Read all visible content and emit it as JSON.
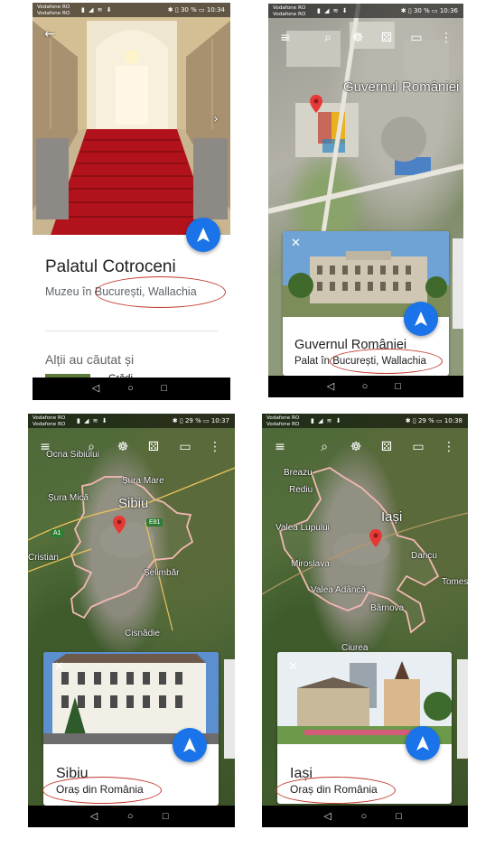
{
  "screens": [
    {
      "status": {
        "carrier1": "Vodafone RO",
        "carrier2": "Vodafone RO",
        "battery": "30 %",
        "time": "10:34"
      },
      "place": {
        "title": "Palatul Cotroceni",
        "subtitle": "Muzeu în București, Wallachia"
      },
      "related_heading": "Alții au căutat și",
      "related_item": "Grădi..."
    },
    {
      "status": {
        "carrier1": "Vodafone RO",
        "carrier2": "Vodafone RO",
        "battery": "30 %",
        "time": "10:36"
      },
      "map_label": "Guvernul României",
      "card": {
        "title": "Guvernul României",
        "subtitle": "Palat în București, Wallachia"
      }
    },
    {
      "status": {
        "carrier1": "Vodafone RO",
        "carrier2": "Vodafone RO",
        "battery": "29 %",
        "time": "10:37"
      },
      "map_labels": [
        "Ocna Sibiului",
        "Șura Mare",
        "Șura Mică",
        "Sibiu",
        "Cristian",
        "Șelimbăr",
        "Cisnădie"
      ],
      "road_badges": [
        "A1",
        "E81"
      ],
      "card": {
        "title": "Sibiu",
        "subtitle": "Oraș din România"
      }
    },
    {
      "status": {
        "carrier1": "Vodafone RO",
        "carrier2": "Vodafone RO",
        "battery": "29 %",
        "time": "10:38"
      },
      "map_labels": [
        "Breazu",
        "Rediu",
        "Iași",
        "Valea Lupului",
        "Dancu",
        "Miroslava",
        "Tomes",
        "Valea Adâncă",
        "Bârnova",
        "Ciurea"
      ],
      "card": {
        "title": "Iași",
        "subtitle": "Oraș din România"
      }
    }
  ],
  "icons": {
    "menu": "menu-icon",
    "search": "search-icon",
    "voyager": "ship-wheel-icon",
    "feeling_lucky": "dice-icon",
    "measure": "ruler-icon",
    "more": "more-vert-icon",
    "back": "arrow-back-icon",
    "next": "chevron-right-icon",
    "close": "close-icon",
    "navigate": "navigation-arrow-icon"
  },
  "colors": {
    "accent_blue": "#1a73e8",
    "boundary": "#f2b8b2",
    "highlight_ellipse": "#c0392b",
    "pin": "#e53935"
  }
}
